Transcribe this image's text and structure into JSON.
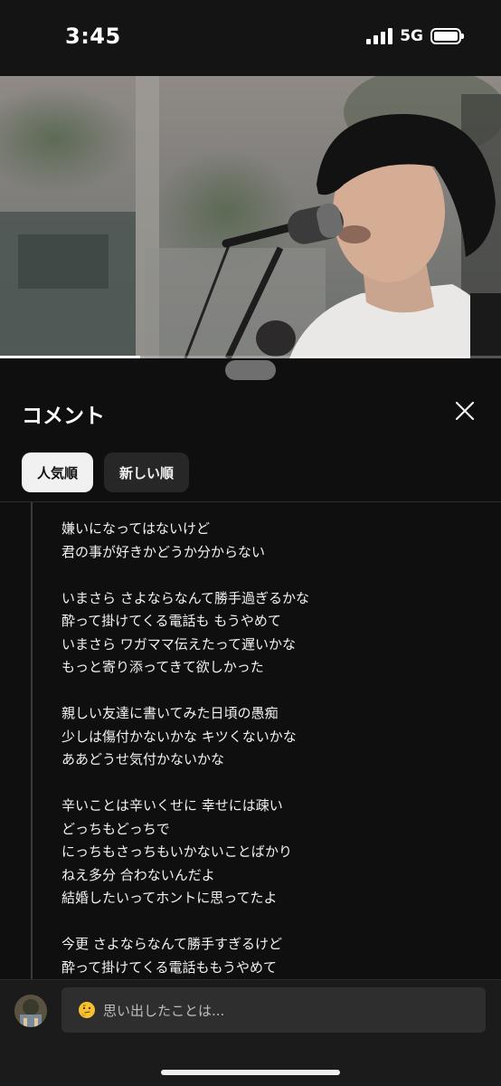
{
  "status_bar": {
    "time": "3:45",
    "network": "5G",
    "battery_level": 1.0
  },
  "video": {
    "progress": 0.28,
    "scene": "musician-singing-into-microphone"
  },
  "comments": {
    "title": "コメント",
    "close_icon": "close-icon",
    "sort_chips": [
      {
        "label": "人気順",
        "active": true
      },
      {
        "label": "新しい順",
        "active": false
      }
    ],
    "lyrics": [
      "嫌いになってはないけど",
      "君の事が好きかどうか分からない",
      "",
      "いまさら さよならなんて勝手過ぎるかな",
      "酔って掛けてくる電話も もうやめて",
      "いまさら ワガママ伝えたって遅いかな",
      "もっと寄り添ってきて欲しかった",
      "",
      "親しい友達に書いてみた日頃の愚痴",
      "少しは傷付かないかな キツくないかな",
      "ああどうせ気付かないかな",
      "",
      "辛いことは辛いくせに 幸せには疎い",
      "どっちもどっちで",
      "にっちもさっちもいかないことばかり",
      "ねえ多分 合わないんだよ",
      "結婚したいってホントに思ってたよ",
      "",
      "今更 さよならなんて勝手すぎるけど",
      "酔って掛けてくる電話ももうやめて"
    ]
  },
  "input": {
    "placeholder": "思い出したことは...",
    "emoji": "thinking-face-icon"
  },
  "colors": {
    "background": "#0f0f0f",
    "chip_active": "#f1f1f1",
    "chip_inactive": "#272727",
    "input_bg": "#2e2e2e"
  }
}
